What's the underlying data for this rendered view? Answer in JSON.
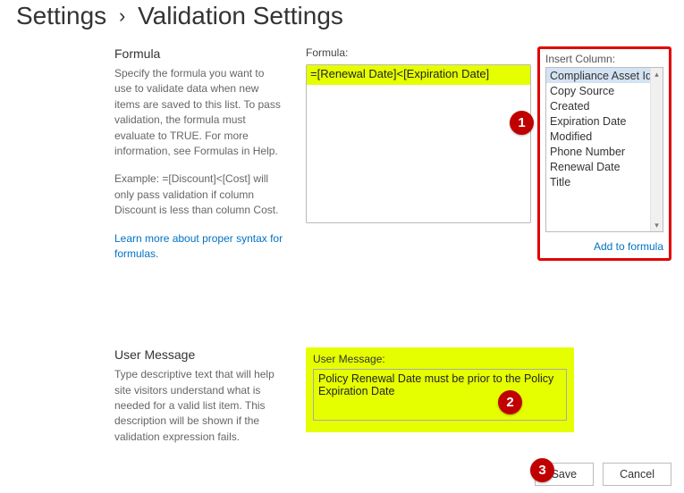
{
  "page": {
    "title_parent": "Settings",
    "title_current": "Validation Settings"
  },
  "formula_section": {
    "heading": "Formula",
    "description": "Specify the formula you want to use to validate data when new items are saved to this list. To pass validation, the formula must evaluate to TRUE. For more information, see Formulas in Help.",
    "example": "Example: =[Discount]<[Cost] will only pass validation if column Discount is less than column Cost.",
    "learn_link": "Learn more about proper syntax for formulas.",
    "field_label": "Formula:",
    "value": "=[Renewal Date]<[Expiration Date]"
  },
  "insert_column": {
    "label": "Insert Column:",
    "items": [
      "Compliance Asset Id",
      "Copy Source",
      "Created",
      "Expiration Date",
      "Modified",
      "Phone Number",
      "Renewal Date",
      "Title"
    ],
    "selected_index": 0,
    "add_link": "Add to formula"
  },
  "user_message_section": {
    "heading": "User Message",
    "description": "Type descriptive text that will help site visitors understand what is needed for a valid list item. This description will be shown if the validation expression fails.",
    "field_label": "User Message:",
    "value": "Policy Renewal Date must be prior to the Policy Expiration Date"
  },
  "buttons": {
    "save": "Save",
    "cancel": "Cancel"
  },
  "callouts": {
    "c1": "1",
    "c2": "2",
    "c3": "3"
  }
}
